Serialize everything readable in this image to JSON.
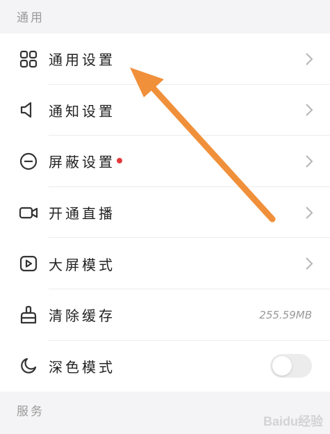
{
  "header": {
    "title": "通用"
  },
  "items": [
    {
      "label": "通用设置",
      "icon": "grid-icon",
      "trailing": "chevron"
    },
    {
      "label": "通知设置",
      "icon": "speaker-icon",
      "trailing": "chevron"
    },
    {
      "label": "屏蔽设置",
      "icon": "block-icon",
      "trailing": "chevron",
      "dot_color": "#e03c3c"
    },
    {
      "label": "开通直播",
      "icon": "video-camera-icon",
      "trailing": "chevron"
    },
    {
      "label": "大屏模式",
      "icon": "play-screen-icon",
      "trailing": "chevron"
    },
    {
      "label": "清除缓存",
      "icon": "broom-icon",
      "trailing": "value",
      "value": "255.59MB"
    },
    {
      "label": "深色模式",
      "icon": "moon-icon",
      "trailing": "toggle",
      "toggle_on": false
    }
  ],
  "footer": {
    "title": "服务"
  },
  "watermark": "Baidu经验",
  "colors": {
    "arrow": "#f0903a",
    "dot": "#e03c3c",
    "background": "#f4f4f6"
  }
}
